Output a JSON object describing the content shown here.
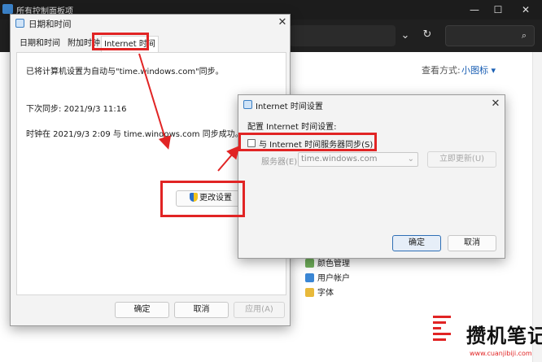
{
  "control_panel": {
    "title": "所有控制面板项",
    "view_by_label": "查看方式:",
    "view_by_value": "小图标 ▾",
    "items": [
      "颜色管理",
      "用户帐户",
      "字体"
    ]
  },
  "datetime_dialog": {
    "title": "日期和时间",
    "tabs": [
      "日期和时间",
      "附加时钟",
      "Internet 时间"
    ],
    "sync_text": "已将计算机设置为自动与\"time.windows.com\"同步。",
    "next_sync": "下次同步: 2021/9/3 11:16",
    "last_sync": "时钟在 2021/9/3 2:09 与 time.windows.com 同步成功。",
    "change_settings_label": "更改设置",
    "ok_label": "确定",
    "cancel_label": "取消",
    "apply_label": "应用(A)"
  },
  "internet_time_dialog": {
    "title": "Internet 时间设置",
    "heading": "配置 Internet 时间设置:",
    "sync_checkbox_label": "与 Internet 时间服务器同步(S)",
    "sync_checked": false,
    "server_label": "服务器(E):",
    "server_value": "time.windows.com",
    "update_now_label": "立即更新(U)",
    "ok_label": "确定",
    "cancel_label": "取消"
  },
  "watermark": {
    "text": "攒机笔记",
    "url": "www.cuanjibiji.com"
  },
  "colors": {
    "annotation_red": "#e12424",
    "dark_chrome": "#1c1c1c",
    "link_blue": "#1a5fb4"
  }
}
